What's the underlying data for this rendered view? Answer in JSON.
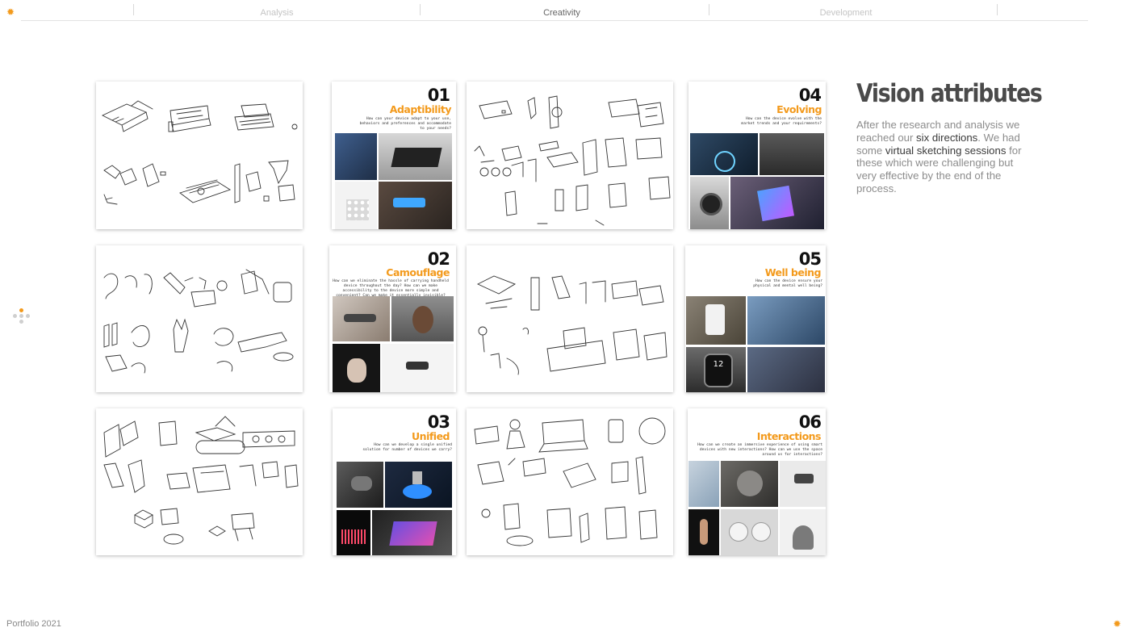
{
  "nav": {
    "items": [
      {
        "label": "Analysis"
      },
      {
        "label": "Creativity"
      },
      {
        "label": "Development"
      }
    ],
    "active": "Creativity"
  },
  "heading": "Vision attributes",
  "description": {
    "p1": "After the research and analysis we reached our ",
    "b1": "six directions",
    "p2": ". We had some ",
    "b2": "virtual sketching sessions",
    "p3": " for these which were challenging but very effective by the end of the process."
  },
  "directions": [
    {
      "num": "01",
      "title": "Adaptibility",
      "question": "How can your device adapt to your use, behaviors and preferences and accommodate to your needs?"
    },
    {
      "num": "02",
      "title": "Camouflage",
      "question": "How can we eliminate the hassle of carrying handheld device throughout the day? How can we make accessibility to the device more simple and convenient? Can we make it essentially invisible?"
    },
    {
      "num": "03",
      "title": "Unified",
      "question": "How can we develop a single unified solution for number of devices we carry?"
    },
    {
      "num": "04",
      "title": "Evolving",
      "question": "How can the device evolve with the market trends and your requirements?"
    },
    {
      "num": "05",
      "title": "Well being",
      "question": "How can the device ensure your physical and mental well being?"
    },
    {
      "num": "06",
      "title": "Interactions",
      "question": "How can we create an immersive experience of using smart devices with new interactions? How can we use the space around us for interactions?"
    }
  ],
  "watch_digits": "12",
  "footer": "Portfolio 2021",
  "colors": {
    "accent": "#f39a1c",
    "heading": "#4a4a4a",
    "body": "#8c8c8c"
  },
  "icons": {
    "corner": "sun-icon",
    "side": "dots-icon"
  }
}
